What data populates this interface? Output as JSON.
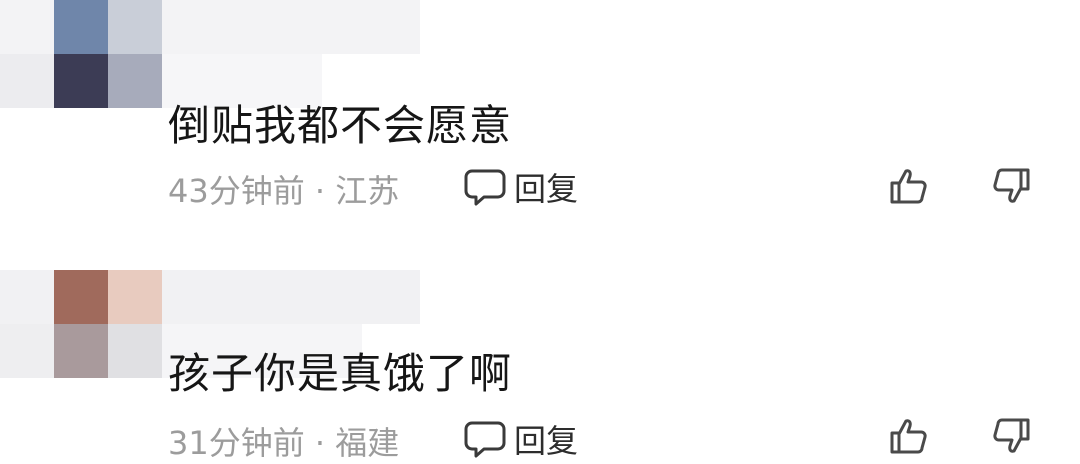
{
  "comments": [
    {
      "text": "倒贴我都不会愿意",
      "meta": "43分钟前 · 江苏",
      "reply_label": "回复",
      "avatar_colors": [
        "#6f86aa",
        "#c9ced8",
        "#3c3c55",
        "#a7abbb"
      ]
    },
    {
      "text": "孩子你是真饿了啊",
      "meta": "31分钟前 · 福建",
      "reply_label": "回复",
      "avatar_colors": [
        "#a06a5c",
        "#e8cbbf",
        "#a99a9c",
        "#e0e0e3"
      ]
    }
  ],
  "icons": {
    "reply": "comment-bubble-icon",
    "like": "thumb-up-icon",
    "dislike": "thumb-down-icon"
  }
}
